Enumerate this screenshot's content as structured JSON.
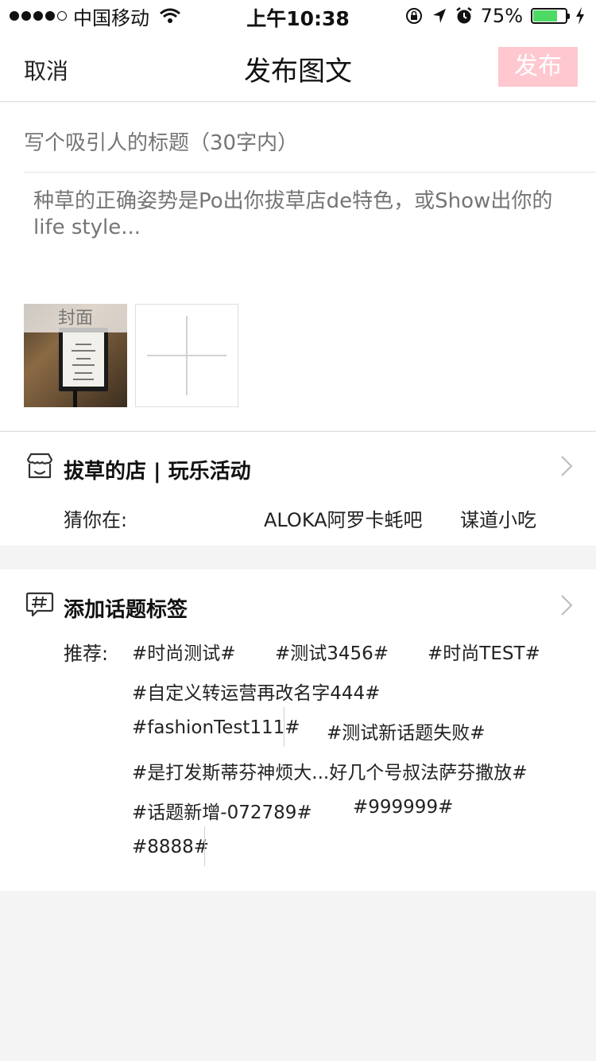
{
  "status_bar": {
    "carrier": "中国移动",
    "time": "上午10:38",
    "battery": "75%",
    "battery_level": 0.75
  },
  "nav": {
    "cancel": "取消",
    "title": "发布图文",
    "publish": "发布"
  },
  "editor": {
    "title_placeholder": "写个吸引人的标题（30字内）",
    "body_placeholder": "种草的正确姿势是Po出你拔草店de特色，或Show出你的life style..."
  },
  "photos": {
    "cover_label": "封面"
  },
  "store": {
    "title": "拔草的店 | 玩乐活动",
    "guess_label": "猜你在:",
    "guesses": [
      "ALOKA阿罗卡蚝吧",
      "谋道小吃"
    ]
  },
  "topics": {
    "title": "添加话题标签",
    "recommend_label": "推荐:",
    "tags": [
      "#时尚测试#",
      "#测试3456#",
      "#时尚TEST#",
      "#自定义转运营再改名字444#",
      "#fashionTest111#",
      "#测试新话题失败#",
      "#是打发斯蒂芬神烦大...好几个号叔法萨芬撒放#",
      "#话题新增-072789#",
      "#999999#",
      "#8888#"
    ]
  },
  "colors": {
    "publish_bg": "#ffc7cf",
    "battery_green": "#4cd964",
    "placeholder": "#c6c6c6"
  }
}
